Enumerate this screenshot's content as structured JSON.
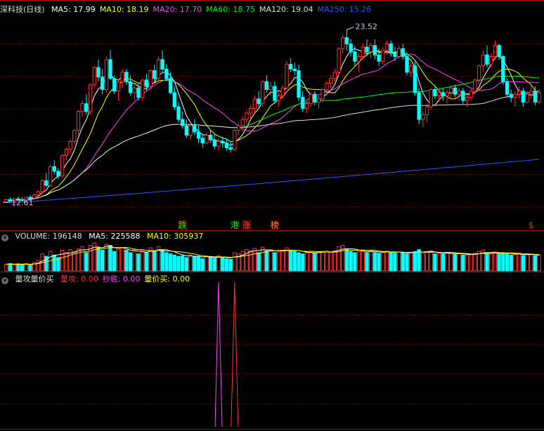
{
  "panel_main": {
    "title": "深科技(日线)",
    "ma": [
      {
        "label": "MA5: 17.99",
        "color": "#ffffff"
      },
      {
        "label": "MA10: 18.19",
        "color": "#ffff00"
      },
      {
        "label": "MA20: 17.70",
        "color": "#ff44ff"
      },
      {
        "label": "MA60: 18.75",
        "color": "#00ff00"
      },
      {
        "label": "MA120: 19.04",
        "color": "#dddddd"
      },
      {
        "label": "MA250: 15.26",
        "color": "#3355ff"
      }
    ],
    "high_label": "23.52",
    "low_label": "12.61",
    "signals": [
      {
        "text": "跌",
        "color": "#00ff00",
        "bg": "#440000",
        "idx": 44
      },
      {
        "text": "港",
        "color": "#00ff00",
        "bg": "#000000",
        "idx": 57
      },
      {
        "text": "涨",
        "color": "#ff4444",
        "bg": "#330000",
        "idx": 60
      },
      {
        "text": "榜",
        "color": "#ff8844",
        "bg": "#330000",
        "idx": 67
      },
      {
        "text": "$",
        "color": "#ff2222",
        "bg": "#000000",
        "idx": 131
      }
    ]
  },
  "panel_volume": {
    "title": "VOLUME: 196148",
    "ma5": "MA5: 225588",
    "ma10": "MA10: 305937"
  },
  "panel_indicator": {
    "title": "量攻量价买",
    "items": [
      {
        "label": "量攻: 0.00",
        "color": "#ff3333"
      },
      {
        "label": "抄底: 0.00",
        "color": "#ff44ff"
      },
      {
        "label": "量价买: 0.00",
        "color": "#ffff33"
      }
    ]
  },
  "colors": {
    "up": "#ff3333",
    "down": "#00ffff",
    "grid": "#8b0000",
    "border": "#b00000"
  },
  "chart_data": {
    "type": "candlestick",
    "price_axis": {
      "min": 12.0,
      "max": 24.5
    },
    "ohlc": [
      [
        12.55,
        12.75,
        12.5,
        12.7
      ],
      [
        12.7,
        12.85,
        12.55,
        12.6
      ],
      [
        12.6,
        12.8,
        12.5,
        12.75
      ],
      [
        12.75,
        12.9,
        12.6,
        12.7
      ],
      [
        12.7,
        12.85,
        12.55,
        12.65
      ],
      [
        12.65,
        12.9,
        12.5,
        12.85
      ],
      [
        12.85,
        13.0,
        12.7,
        12.8
      ],
      [
        12.8,
        13.1,
        12.7,
        13.0
      ],
      [
        13.0,
        13.3,
        12.9,
        13.2
      ],
      [
        13.2,
        14.0,
        13.1,
        13.9
      ],
      [
        13.9,
        14.4,
        13.5,
        13.6
      ],
      [
        13.6,
        14.9,
        13.5,
        14.8
      ],
      [
        14.8,
        15.2,
        14.3,
        14.5
      ],
      [
        14.5,
        14.7,
        14.0,
        14.2
      ],
      [
        14.2,
        15.6,
        14.1,
        15.5
      ],
      [
        15.5,
        16.0,
        15.2,
        15.9
      ],
      [
        15.9,
        16.5,
        15.6,
        16.4
      ],
      [
        16.4,
        17.2,
        16.2,
        17.1
      ],
      [
        17.1,
        18.4,
        16.8,
        18.3
      ],
      [
        18.3,
        19.0,
        18.0,
        18.8
      ],
      [
        18.8,
        19.4,
        18.1,
        18.3
      ],
      [
        18.3,
        20.1,
        18.1,
        20.0
      ],
      [
        20.0,
        21.2,
        19.8,
        21.1
      ],
      [
        21.1,
        21.6,
        20.2,
        20.5
      ],
      [
        20.5,
        21.0,
        19.4,
        19.7
      ],
      [
        19.7,
        21.8,
        19.5,
        21.6
      ],
      [
        21.6,
        22.2,
        20.3,
        20.4
      ],
      [
        20.4,
        20.6,
        19.4,
        19.6
      ],
      [
        19.6,
        20.3,
        19.0,
        20.2
      ],
      [
        20.2,
        21.0,
        19.8,
        20.8
      ],
      [
        20.8,
        21.0,
        20.0,
        20.2
      ],
      [
        20.2,
        20.6,
        19.3,
        19.5
      ],
      [
        19.5,
        20.0,
        19.0,
        19.8
      ],
      [
        19.8,
        20.1,
        19.0,
        19.2
      ],
      [
        19.2,
        20.4,
        19.0,
        20.3
      ],
      [
        20.3,
        20.7,
        19.6,
        19.9
      ],
      [
        19.9,
        21.0,
        19.7,
        20.9
      ],
      [
        20.9,
        21.3,
        20.1,
        20.4
      ],
      [
        20.4,
        21.8,
        20.2,
        21.6
      ],
      [
        21.6,
        22.2,
        20.8,
        21.0
      ],
      [
        21.0,
        21.3,
        20.2,
        20.4
      ],
      [
        20.4,
        20.8,
        19.4,
        19.5
      ],
      [
        19.5,
        19.9,
        18.4,
        18.6
      ],
      [
        18.6,
        18.9,
        17.6,
        17.8
      ],
      [
        17.8,
        18.3,
        17.2,
        17.4
      ],
      [
        17.4,
        17.8,
        16.6,
        16.8
      ],
      [
        16.8,
        17.6,
        16.5,
        17.4
      ],
      [
        17.4,
        17.8,
        16.8,
        17.0
      ],
      [
        17.0,
        17.4,
        16.3,
        16.6
      ],
      [
        16.6,
        16.9,
        16.0,
        16.3
      ],
      [
        16.3,
        17.0,
        16.2,
        16.8
      ],
      [
        16.8,
        17.1,
        16.3,
        16.5
      ],
      [
        16.5,
        16.9,
        15.9,
        16.1
      ],
      [
        16.1,
        16.6,
        15.8,
        16.4
      ],
      [
        16.4,
        16.7,
        16.0,
        16.3
      ],
      [
        16.3,
        16.6,
        15.8,
        16.0
      ],
      [
        16.0,
        16.4,
        15.7,
        15.9
      ],
      [
        15.9,
        17.2,
        15.8,
        17.1
      ],
      [
        17.1,
        17.6,
        16.8,
        17.4
      ],
      [
        17.4,
        18.0,
        17.0,
        17.8
      ],
      [
        17.8,
        18.4,
        17.5,
        18.2
      ],
      [
        18.2,
        18.7,
        17.8,
        18.5
      ],
      [
        18.5,
        19.3,
        18.2,
        19.1
      ],
      [
        19.1,
        19.6,
        18.6,
        18.8
      ],
      [
        18.8,
        20.3,
        18.6,
        20.2
      ],
      [
        20.2,
        20.6,
        19.5,
        19.7
      ],
      [
        19.7,
        20.2,
        19.3,
        19.9
      ],
      [
        19.9,
        20.2,
        18.8,
        19.0
      ],
      [
        19.0,
        19.5,
        18.6,
        19.3
      ],
      [
        19.3,
        20.0,
        19.1,
        19.8
      ],
      [
        19.8,
        21.5,
        19.7,
        21.3
      ],
      [
        21.3,
        21.7,
        20.8,
        21.0
      ],
      [
        21.0,
        21.4,
        20.6,
        20.9
      ],
      [
        20.9,
        21.3,
        19.0,
        19.2
      ],
      [
        19.2,
        19.6,
        18.3,
        18.5
      ],
      [
        18.5,
        19.0,
        18.2,
        18.8
      ],
      [
        18.8,
        19.5,
        18.6,
        19.4
      ],
      [
        19.4,
        19.6,
        18.7,
        18.9
      ],
      [
        18.9,
        19.3,
        18.5,
        19.1
      ],
      [
        19.1,
        19.8,
        18.9,
        19.7
      ],
      [
        19.7,
        20.2,
        19.3,
        20.1
      ],
      [
        20.1,
        20.6,
        19.8,
        20.4
      ],
      [
        20.4,
        21.0,
        20.2,
        20.8
      ],
      [
        20.8,
        22.4,
        20.6,
        22.3
      ],
      [
        22.3,
        23.2,
        22.0,
        23.0
      ],
      [
        23.0,
        23.5,
        22.2,
        22.6
      ],
      [
        22.6,
        22.9,
        21.8,
        22.1
      ],
      [
        22.1,
        22.5,
        21.2,
        21.5
      ],
      [
        21.5,
        22.0,
        20.8,
        21.8
      ],
      [
        21.8,
        22.6,
        21.6,
        22.4
      ],
      [
        22.4,
        22.9,
        21.8,
        22.1
      ],
      [
        22.1,
        22.7,
        21.7,
        22.5
      ],
      [
        22.5,
        22.9,
        21.6,
        21.9
      ],
      [
        21.9,
        22.3,
        21.2,
        21.5
      ],
      [
        21.5,
        22.4,
        21.3,
        22.2
      ],
      [
        22.2,
        22.8,
        21.9,
        22.6
      ],
      [
        22.6,
        22.8,
        21.8,
        22.0
      ],
      [
        22.0,
        22.4,
        21.5,
        21.8
      ],
      [
        21.8,
        22.5,
        21.7,
        22.3
      ],
      [
        22.3,
        22.6,
        21.6,
        21.8
      ],
      [
        21.8,
        22.1,
        20.6,
        20.8
      ],
      [
        20.8,
        21.4,
        20.5,
        21.2
      ],
      [
        21.2,
        21.5,
        19.3,
        19.5
      ],
      [
        19.5,
        19.8,
        17.5,
        17.8
      ],
      [
        17.8,
        18.3,
        17.3,
        18.1
      ],
      [
        18.1,
        18.8,
        17.6,
        18.6
      ],
      [
        18.6,
        19.8,
        18.4,
        19.7
      ],
      [
        19.7,
        20.0,
        19.1,
        19.3
      ],
      [
        19.3,
        19.7,
        18.9,
        19.5
      ],
      [
        19.5,
        19.8,
        19.0,
        19.3
      ],
      [
        19.3,
        19.7,
        18.8,
        19.5
      ],
      [
        19.5,
        20.0,
        19.2,
        19.8
      ],
      [
        19.8,
        20.0,
        19.2,
        19.4
      ],
      [
        19.4,
        19.8,
        19.0,
        19.6
      ],
      [
        19.6,
        19.8,
        18.8,
        19.0
      ],
      [
        19.0,
        19.4,
        18.6,
        19.2
      ],
      [
        19.2,
        19.8,
        19.0,
        19.6
      ],
      [
        19.6,
        20.4,
        19.4,
        20.3
      ],
      [
        20.3,
        21.3,
        20.0,
        21.2
      ],
      [
        21.2,
        22.2,
        20.8,
        21.9
      ],
      [
        21.9,
        22.5,
        21.1,
        21.3
      ],
      [
        21.3,
        22.0,
        21.1,
        21.8
      ],
      [
        21.8,
        22.8,
        21.6,
        22.5
      ],
      [
        22.5,
        22.6,
        21.6,
        21.8
      ],
      [
        21.8,
        21.9,
        20.0,
        20.2
      ],
      [
        20.2,
        20.4,
        19.2,
        19.4
      ],
      [
        19.4,
        19.7,
        18.9,
        19.2
      ],
      [
        19.2,
        19.6,
        18.6,
        19.4
      ],
      [
        19.4,
        19.9,
        19.1,
        19.6
      ],
      [
        19.6,
        19.8,
        18.6,
        18.9
      ],
      [
        18.9,
        19.6,
        18.8,
        19.4
      ],
      [
        19.4,
        19.9,
        19.1,
        19.6
      ],
      [
        19.6,
        19.9,
        18.7,
        18.9
      ],
      [
        18.9,
        19.7,
        18.8,
        19.5
      ]
    ],
    "volume": [
      55,
      60,
      50,
      58,
      52,
      62,
      48,
      70,
      85,
      140,
      120,
      160,
      130,
      110,
      170,
      150,
      175,
      160,
      180,
      200,
      150,
      210,
      230,
      190,
      170,
      220,
      210,
      160,
      180,
      190,
      170,
      150,
      160,
      140,
      170,
      150,
      190,
      160,
      200,
      170,
      150,
      140,
      130,
      120,
      125,
      110,
      130,
      115,
      120,
      100,
      120,
      115,
      105,
      125,
      110,
      100,
      95,
      150,
      140,
      160,
      175,
      165,
      185,
      150,
      195,
      165,
      170,
      150,
      160,
      170,
      190,
      165,
      160,
      150,
      140,
      150,
      160,
      145,
      155,
      160,
      165,
      155,
      165,
      200,
      210,
      175,
      160,
      150,
      160,
      170,
      150,
      165,
      150,
      145,
      160,
      165,
      150,
      145,
      155,
      150,
      140,
      155,
      160,
      175,
      145,
      155,
      165,
      140,
      145,
      140,
      145,
      150,
      135,
      140,
      130,
      130,
      135,
      145,
      160,
      170,
      140,
      145,
      155,
      140,
      150,
      140,
      130,
      135,
      140,
      125,
      140,
      135,
      125,
      130
    ],
    "ma_values_last": {
      "MA5": 17.99,
      "MA10": 18.19,
      "MA20": 17.7,
      "MA60": 18.75,
      "MA120": 19.04,
      "MA250": 15.26
    },
    "high": 23.52,
    "low": 12.61,
    "volume_last": 196148,
    "volume_ma": {
      "MA5": 225588,
      "MA10": 305937
    },
    "indicator": {
      "量攻": 0.0,
      "抄底": 0.0,
      "量价买": 0.0,
      "spikes": [
        {
          "idx": 53,
          "color": "#ff44ff"
        },
        {
          "idx": 57,
          "color": "#ff3333"
        }
      ]
    }
  }
}
